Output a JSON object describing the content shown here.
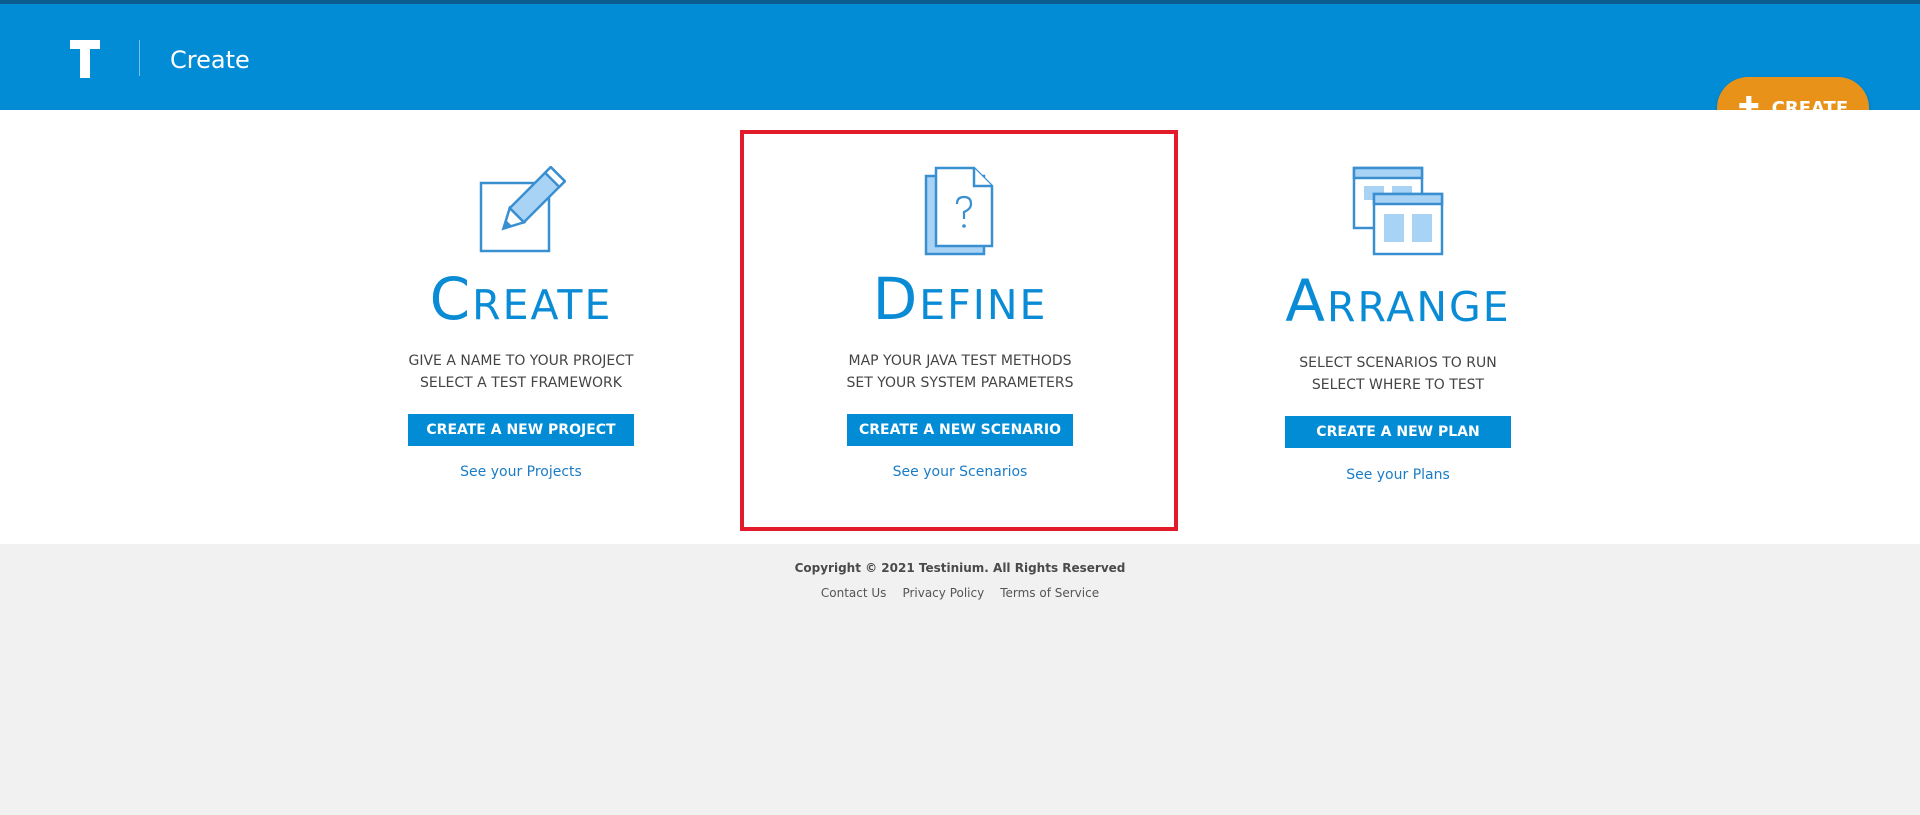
{
  "header": {
    "logo_letter": "T",
    "title": "Create",
    "create_button_label": "CREATE"
  },
  "cards": [
    {
      "title": "Create",
      "desc_line1": "GIVE A NAME TO YOUR PROJECT",
      "desc_line2": "SELECT A TEST FRAMEWORK",
      "button_label": "CREATE A NEW PROJECT",
      "link_label": "See your Projects",
      "icon": "edit-pencil-icon"
    },
    {
      "title": "Define",
      "desc_line1": "MAP YOUR JAVA TEST METHODS",
      "desc_line2": "SET YOUR SYSTEM PARAMETERS",
      "button_label": "CREATE A NEW SCENARIO",
      "link_label": "See your Scenarios",
      "icon": "document-question-icon",
      "highlighted": true
    },
    {
      "title": "Arrange",
      "desc_line1": "SELECT SCENARIOS TO RUN",
      "desc_line2": "SELECT WHERE TO TEST",
      "button_label": "CREATE A NEW PLAN",
      "link_label": "See your Plans",
      "icon": "layout-windows-icon"
    }
  ],
  "footer": {
    "copyright": "Copyright © 2021 Testinium. All Rights Reserved",
    "links": [
      "Contact Us",
      "Privacy Policy",
      "Terms of Service"
    ]
  },
  "colors": {
    "header_blue": "#028cd6",
    "accent_orange": "#e8921a",
    "highlight_red": "#e21b2a"
  }
}
